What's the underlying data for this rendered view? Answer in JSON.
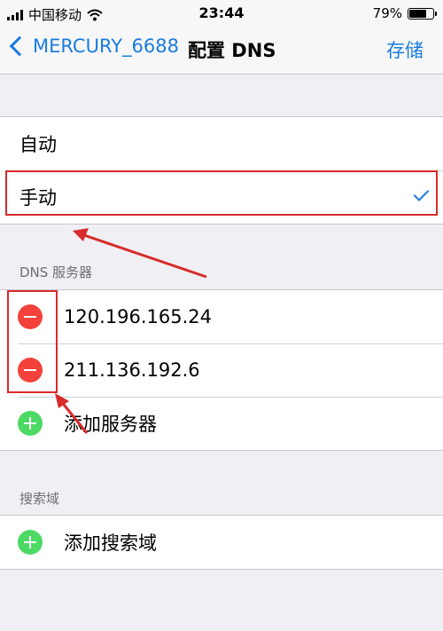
{
  "status_bar": {
    "carrier": "中国移动",
    "time": "23:44",
    "battery_percent": "79%",
    "battery_level": 0.79
  },
  "nav": {
    "back_label": "MERCURY_6688",
    "title": "配置 DNS",
    "save_label": "存储"
  },
  "mode": {
    "options": [
      "自动",
      "手动"
    ],
    "selected": "手动"
  },
  "dns": {
    "header": "DNS 服务器",
    "servers": [
      "120.196.165.24",
      "211.136.192.6"
    ],
    "add_label": "添加服务器"
  },
  "search_domain": {
    "header": "搜索域",
    "add_label": "添加搜索域"
  },
  "colors": {
    "accent": "#1a7ce0",
    "delete": "#f3413b",
    "add": "#4cd964",
    "annotation": "#d82b2b"
  }
}
